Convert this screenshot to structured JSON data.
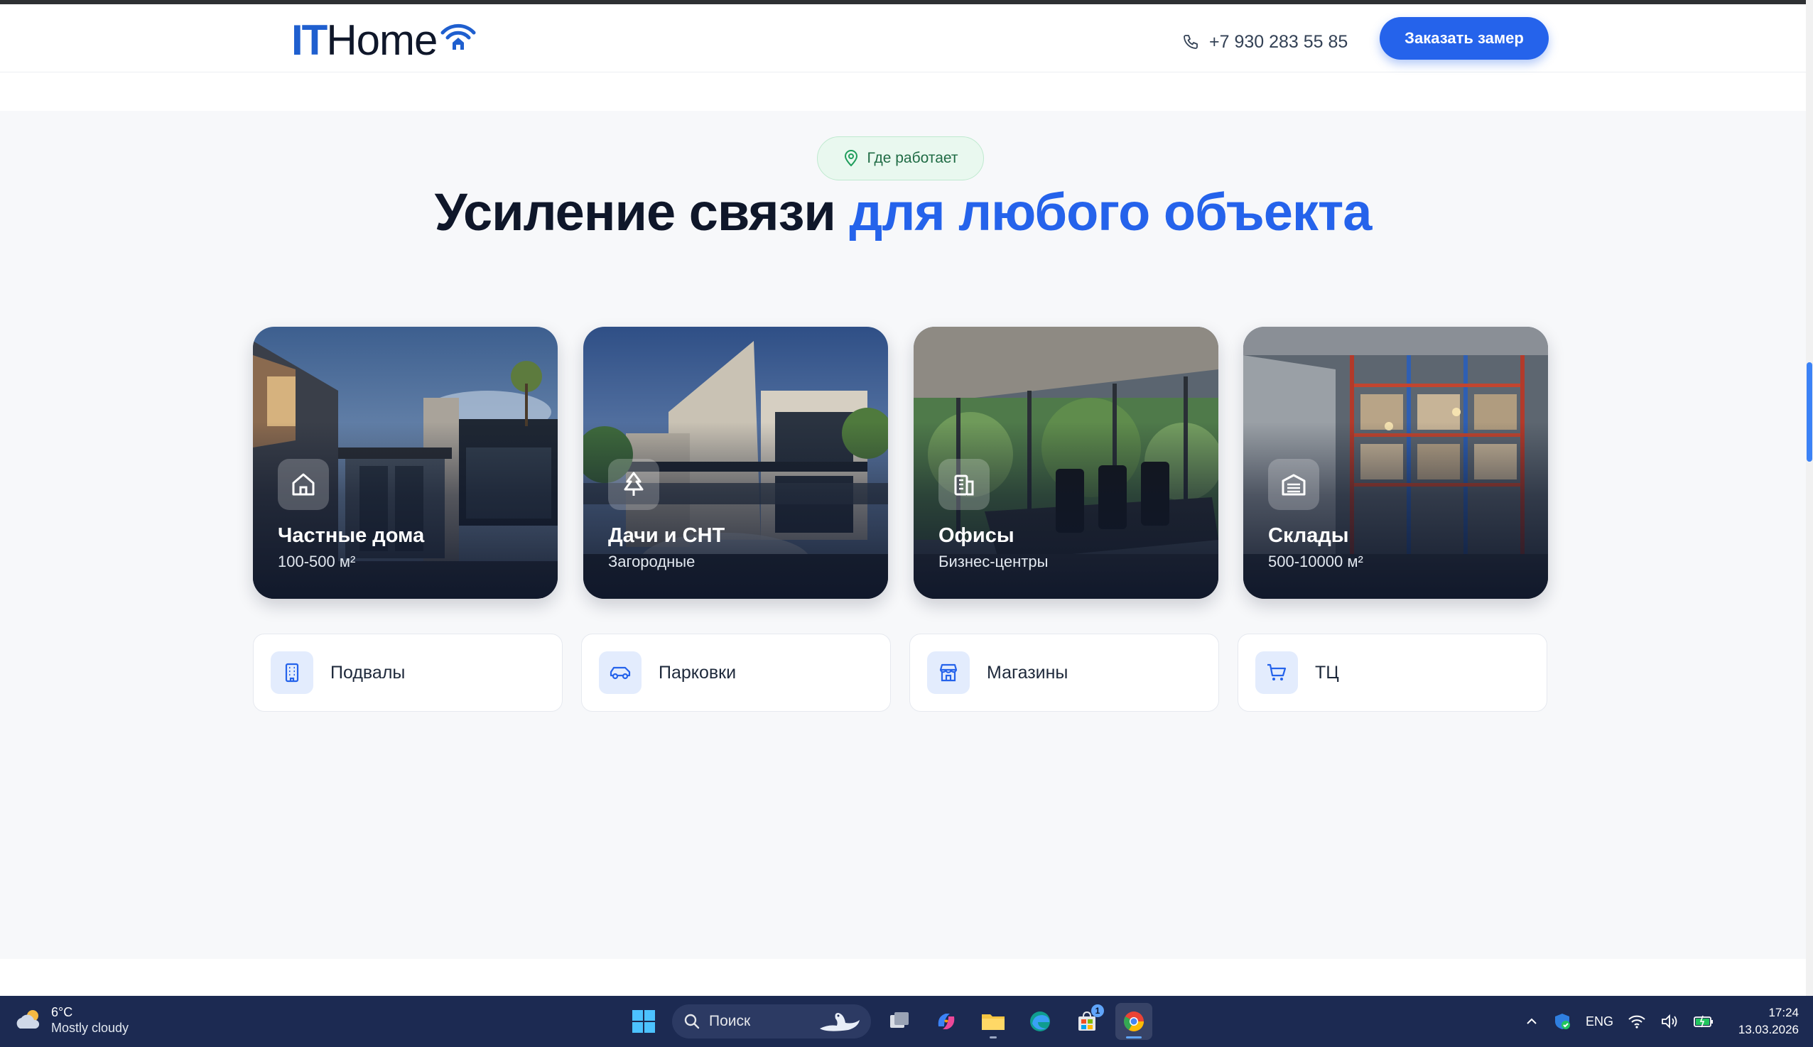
{
  "header": {
    "logo_it": "IT",
    "logo_home": "Home",
    "phone": "+7 930 283 55 85",
    "cta_label": "Заказать замер",
    "brand_color": "#2563eb"
  },
  "section": {
    "badge_label": "Где работает",
    "headline_main": "Усиление связи ",
    "headline_accent": "для любого объекта",
    "cards": [
      {
        "title": "Частные дома",
        "subtitle": "100-500 м²",
        "icon": "house-icon"
      },
      {
        "title": "Дачи и СНТ",
        "subtitle": "Загородные",
        "icon": "tree-icon"
      },
      {
        "title": "Офисы",
        "subtitle": "Бизнес-центры",
        "icon": "office-building-icon"
      },
      {
        "title": "Склады",
        "subtitle": "500-10000 м²",
        "icon": "warehouse-icon"
      }
    ],
    "mini_cards": [
      {
        "label": "Подвалы",
        "icon": "building-icon"
      },
      {
        "label": "Парковки",
        "icon": "car-icon"
      },
      {
        "label": "Магазины",
        "icon": "store-icon"
      },
      {
        "label": "ТЦ",
        "icon": "cart-icon"
      }
    ]
  },
  "taskbar": {
    "weather_temp": "6°C",
    "weather_desc": "Mostly cloudy",
    "search_placeholder": "Поиск",
    "lang": "ENG",
    "time": "17:24",
    "date": "13.03.2026",
    "store_badge": "1"
  }
}
